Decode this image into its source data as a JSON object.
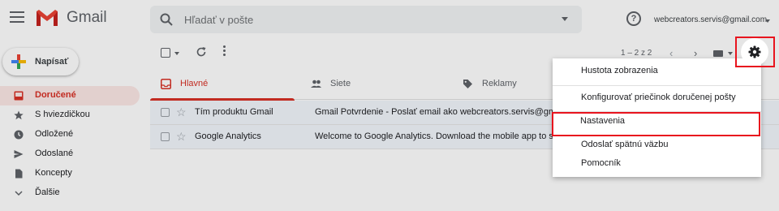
{
  "app": {
    "name": "Gmail"
  },
  "header": {
    "search_placeholder": "Hľadať v pošte",
    "account_email": "webcreators.servis@gmail.com"
  },
  "sidebar": {
    "compose_label": "Napísať",
    "items": [
      {
        "label": "Doručené",
        "icon": "inbox-icon",
        "active": true
      },
      {
        "label": "S hviezdičkou",
        "icon": "star-icon"
      },
      {
        "label": "Odložené",
        "icon": "clock-icon"
      },
      {
        "label": "Odoslané",
        "icon": "send-icon"
      },
      {
        "label": "Koncepty",
        "icon": "draft-icon"
      },
      {
        "label": "Ďalšie",
        "icon": "chevron-down-icon"
      }
    ]
  },
  "toolbar": {
    "pager": "1 – 2 z 2"
  },
  "tabs": [
    {
      "label": "Hlavné",
      "icon": "inbox-icon",
      "active": true
    },
    {
      "label": "Siete",
      "icon": "people-icon"
    },
    {
      "label": "Reklamy",
      "icon": "tag-icon"
    }
  ],
  "emails": [
    {
      "sender": "Tím produktu Gmail",
      "subject": "Gmail Potvrdenie - Poslať email ako webcreators.servis@gmail.com"
    },
    {
      "sender": "Google Analytics",
      "subject": "Welcome to Google Analytics. Download the mobile app to see"
    }
  ],
  "settings_menu": {
    "items": [
      {
        "label": "Hustota zobrazenia"
      },
      {
        "label": "Konfigurovať priečinok doručenej pošty"
      },
      {
        "label": "Nastavenia",
        "highlighted": true
      },
      {
        "label": "Odoslať spätnú väzbu"
      },
      {
        "label": "Pomocník"
      }
    ]
  },
  "colors": {
    "accent_red": "#d93025",
    "highlight_red": "#e8141e"
  }
}
